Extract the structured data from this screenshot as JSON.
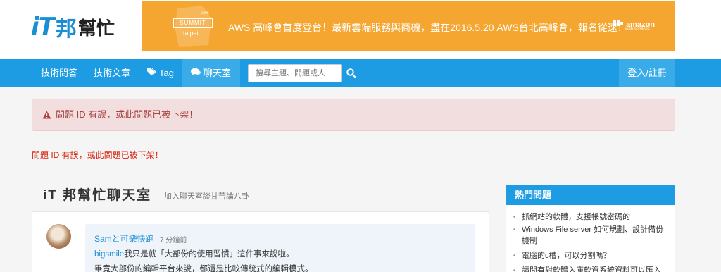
{
  "brand": {
    "logo_it": "iT",
    "logo_bang": "邦",
    "logo_help": "幫忙"
  },
  "banner": {
    "badge_top": "aws",
    "badge_summit": "SUMMIT",
    "badge_city": "taipei",
    "text": "AWS 高峰會首度登台！最新雲端服務與商機，盡在2016.5.20 AWS台北高峰會，報名從速！",
    "sponsor": "amazon",
    "sponsor_sub": "web services",
    "bg_color": "#f5a631"
  },
  "nav": {
    "items": [
      {
        "label": "技術問答"
      },
      {
        "label": "技術文章"
      },
      {
        "label": "Tag",
        "icon": "tags-icon"
      },
      {
        "label": "聊天室",
        "icon": "comments-icon"
      }
    ],
    "search_placeholder": "搜尋主題、問題或人",
    "login": "登入/註冊",
    "bg_color": "#1d9ce3"
  },
  "alert": {
    "message": "問題 ID 有誤，或此問題已被下架！"
  },
  "error_line": "問題 ID 有誤，或此問題已被下架！",
  "room": {
    "title": "iT 邦幫忙聊天室",
    "subtitle": "加入聊天室談甘苦論八卦"
  },
  "message": {
    "author": "Samと可樂快跑",
    "time": "7 分鐘前",
    "mention": "bigsmile",
    "line1": "我只是就「大部份的使用習慣」這件事來說啦。",
    "line2": "畢竟大部份的編輯平台來說，都還是比較傳統式的編輯模式。"
  },
  "hot": {
    "title": "熱門問題",
    "items": [
      "抓網站的軟體，支援帳號密碼的",
      "Windows File server 如何規劃、設計備份機制",
      "電腦的c槽，可以分割嗎？",
      "請問有對軟體入庫軟資系統資料可以匯入"
    ]
  }
}
